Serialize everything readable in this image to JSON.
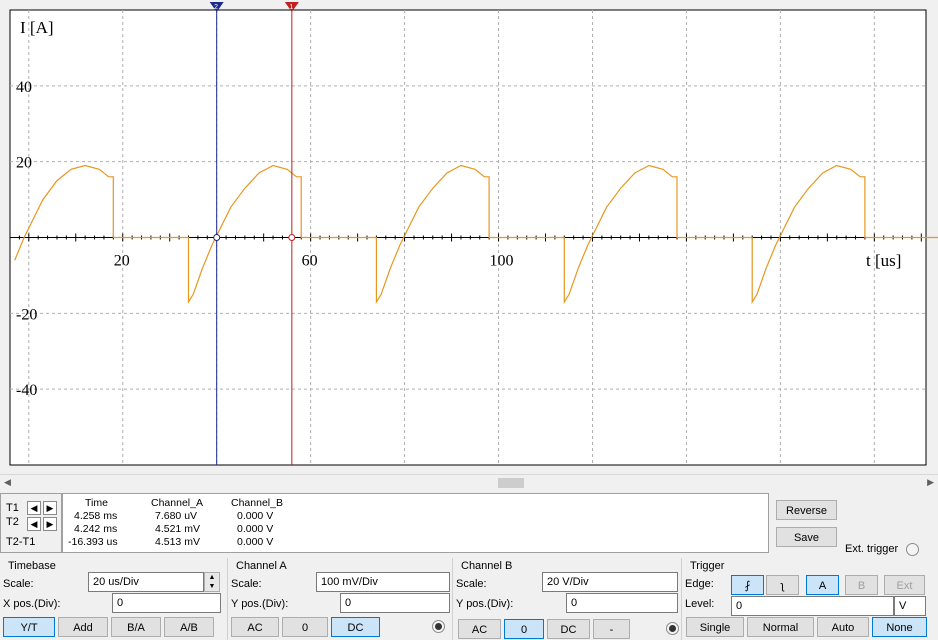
{
  "chart_data": {
    "type": "line",
    "ylabel": "I [A]",
    "xlabel": "t [us]",
    "x_ticks": [
      20,
      60,
      100
    ],
    "y_ticks": [
      40,
      20,
      -20,
      -40
    ],
    "xlim": [
      -4,
      191
    ],
    "ylim": [
      -60,
      60
    ],
    "grid": true,
    "series": [
      {
        "color": "#e8961e",
        "points": [
          [
            -3,
            -6
          ],
          [
            -1,
            0
          ],
          [
            1,
            5
          ],
          [
            3,
            10
          ],
          [
            6,
            15
          ],
          [
            9,
            18
          ],
          [
            12,
            19
          ],
          [
            15,
            18
          ],
          [
            17,
            16
          ],
          [
            18,
            16
          ],
          [
            18,
            0
          ],
          [
            34,
            0
          ],
          [
            34,
            -17
          ],
          [
            35,
            -15
          ],
          [
            37,
            -8
          ],
          [
            39,
            -2
          ],
          [
            41,
            3
          ],
          [
            43,
            8
          ],
          [
            46,
            13
          ],
          [
            49,
            17
          ],
          [
            52,
            19
          ],
          [
            55,
            18
          ],
          [
            57,
            16
          ],
          [
            58,
            16
          ],
          [
            58,
            0
          ],
          [
            74,
            0
          ],
          [
            74,
            -17
          ],
          [
            75,
            -15
          ],
          [
            77,
            -8
          ],
          [
            79,
            -2
          ],
          [
            81,
            3
          ],
          [
            83,
            8
          ],
          [
            86,
            13
          ],
          [
            89,
            17
          ],
          [
            92,
            19
          ],
          [
            95,
            18
          ],
          [
            97,
            16
          ],
          [
            98,
            16
          ],
          [
            98,
            0
          ],
          [
            114,
            0
          ],
          [
            114,
            -17
          ],
          [
            115,
            -15
          ],
          [
            117,
            -8
          ],
          [
            119,
            -2
          ],
          [
            121,
            3
          ],
          [
            123,
            8
          ],
          [
            126,
            13
          ],
          [
            129,
            17
          ],
          [
            132,
            19
          ],
          [
            135,
            18
          ],
          [
            137,
            16
          ],
          [
            138,
            16
          ],
          [
            138,
            0
          ],
          [
            154,
            0
          ],
          [
            154,
            -17
          ],
          [
            155,
            -15
          ],
          [
            157,
            -8
          ],
          [
            159,
            -2
          ],
          [
            161,
            3
          ],
          [
            163,
            8
          ],
          [
            166,
            13
          ],
          [
            169,
            17
          ],
          [
            172,
            19
          ],
          [
            175,
            18
          ],
          [
            177,
            16
          ],
          [
            178,
            16
          ],
          [
            178,
            0
          ],
          [
            194,
            0
          ],
          [
            194,
            -17
          ],
          [
            195,
            -15
          ]
        ]
      }
    ],
    "cursors": [
      {
        "name": "2",
        "x": 40,
        "color": "#1c2a8c"
      },
      {
        "name": "1",
        "x": 56,
        "color": "#c02020"
      }
    ]
  },
  "cursor_panel": {
    "t1": "T1",
    "t2": "T2",
    "t2t1": "T2-T1",
    "headers": [
      "Time",
      "Channel_A",
      "Channel_B"
    ],
    "rows": [
      [
        "4.258 ms",
        "7.680 uV",
        "0.000 V"
      ],
      [
        "4.242 ms",
        "4.521 mV",
        "0.000 V"
      ],
      [
        "-16.393 us",
        "4.513 mV",
        "0.000 V"
      ]
    ],
    "left_arrow": "◀",
    "right_arrow": "▶",
    "reverse": "Reverse",
    "save": "Save",
    "ext_trigger": "Ext. trigger"
  },
  "timebase": {
    "title": "Timebase",
    "scale_label": "Scale:",
    "scale_value": "20 us/Div",
    "xpos_label": "X pos.(Div):",
    "xpos_value": "0",
    "buttons": [
      "Y/T",
      "Add",
      "B/A",
      "A/B"
    ]
  },
  "channel_a": {
    "title": "Channel A",
    "scale_label": "Scale:",
    "scale_value": "100 mV/Div",
    "ypos_label": "Y pos.(Div):",
    "ypos_value": "0",
    "buttons": [
      "AC",
      "0",
      "DC"
    ]
  },
  "channel_b": {
    "title": "Channel B",
    "scale_label": "Scale:",
    "scale_value": "20  V/Div",
    "ypos_label": "Y pos.(Div):",
    "ypos_value": "0",
    "buttons": [
      "AC",
      "0",
      "DC",
      "-"
    ]
  },
  "trigger": {
    "title": "Trigger",
    "edge_label": "Edge:",
    "level_label": "Level:",
    "level_value": "0",
    "level_unit": "V",
    "edge_rise": "⨏",
    "edge_fall": "ʅ",
    "sources": [
      "A",
      "B",
      "Ext"
    ],
    "modes": [
      "Single",
      "Normal",
      "Auto",
      "None"
    ]
  }
}
